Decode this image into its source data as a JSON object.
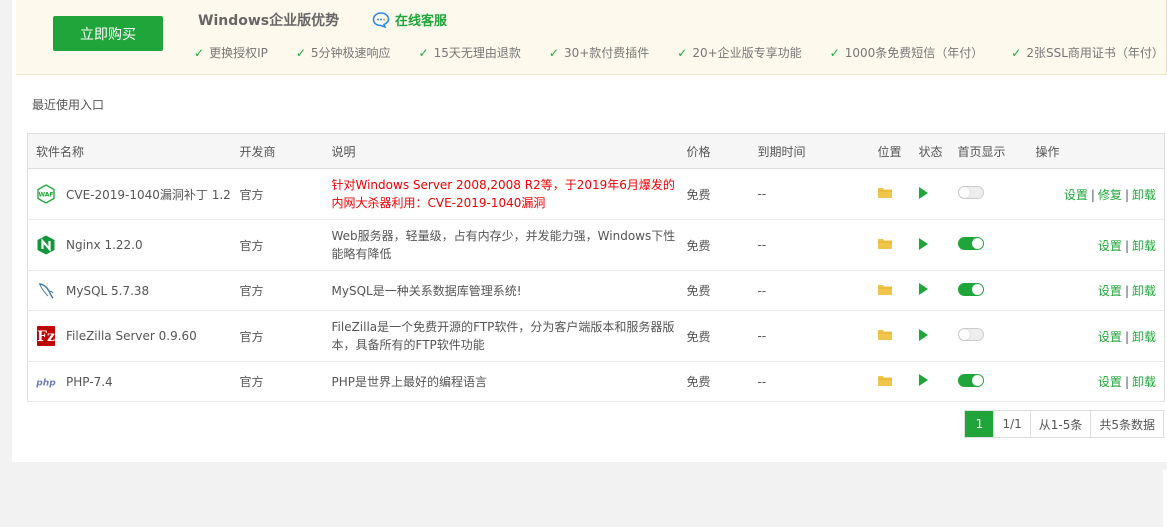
{
  "promo": {
    "buy_button": "立即购买",
    "title": "Windows企业版优势",
    "service": "在线客服",
    "features": [
      "更换授权IP",
      "5分钟极速响应",
      "15天无理由退款",
      "30+款付费插件",
      "20+企业版专享功能",
      "1000条免费短信（年付）",
      "2张SSL商用证书（年付）"
    ]
  },
  "recent_label": "最近使用入口",
  "table": {
    "headers": {
      "name": "软件名称",
      "developer": "开发商",
      "desc": "说明",
      "price": "价格",
      "expire": "到期时间",
      "location": "位置",
      "status": "状态",
      "home": "首页显示",
      "ops": "操作"
    },
    "rows": [
      {
        "name": "CVE-2019-1040漏洞补丁 1.2",
        "icon": "waf-icon",
        "developer": "官方",
        "desc": "针对Windows Server 2008,2008 R2等，于2019年6月爆发的内网大杀器利用：CVE-2019-1040漏洞",
        "price": "免费",
        "expire": "--",
        "home_on": false,
        "ops": [
          "设置",
          "修复",
          "卸载"
        ]
      },
      {
        "name": "Nginx 1.22.0",
        "icon": "nginx-icon",
        "developer": "官方",
        "desc": "Web服务器，轻量级，占有内存少，并发能力强，Windows下性能略有降低",
        "price": "免费",
        "expire": "--",
        "home_on": true,
        "ops": [
          "设置",
          "卸载"
        ]
      },
      {
        "name": "MySQL 5.7.38",
        "icon": "mysql-icon",
        "developer": "官方",
        "desc": "MySQL是一种关系数据库管理系统!",
        "price": "免费",
        "expire": "--",
        "home_on": true,
        "ops": [
          "设置",
          "卸载"
        ]
      },
      {
        "name": "FileZilla Server 0.9.60",
        "icon": "filezilla-icon",
        "developer": "官方",
        "desc": "FileZilla是一个免费开源的FTP软件，分为客户端版本和服务器版本，具备所有的FTP软件功能",
        "price": "免费",
        "expire": "--",
        "home_on": false,
        "ops": [
          "设置",
          "卸载"
        ]
      },
      {
        "name": "PHP-7.4",
        "icon": "php-icon",
        "developer": "官方",
        "desc": "PHP是世界上最好的编程语言",
        "price": "免费",
        "expire": "--",
        "home_on": true,
        "ops": [
          "设置",
          "卸载"
        ]
      }
    ]
  },
  "pager": {
    "current": "1",
    "pages": "1/1",
    "range": "从1-5条",
    "total": "共5条数据"
  },
  "colors": {
    "accent": "#20a53a",
    "danger": "#e00000",
    "folder": "#f0c54c"
  }
}
